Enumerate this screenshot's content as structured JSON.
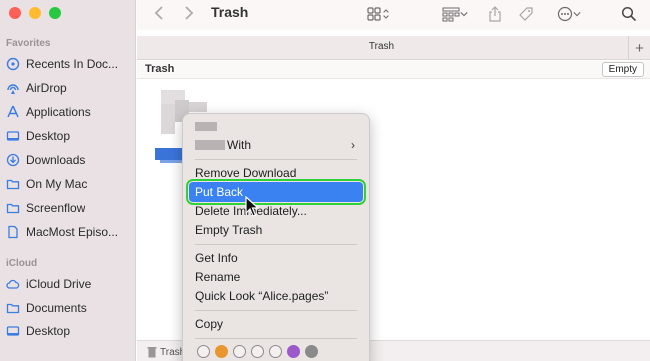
{
  "sidebar": {
    "favorites_label": "Favorites",
    "icloud_label": "iCloud",
    "favorites": [
      {
        "label": "Recents In Doc...",
        "icon": "recents-icon"
      },
      {
        "label": "AirDrop",
        "icon": "airdrop-icon"
      },
      {
        "label": "Applications",
        "icon": "applications-icon"
      },
      {
        "label": "Desktop",
        "icon": "desktop-icon"
      },
      {
        "label": "Downloads",
        "icon": "downloads-icon"
      },
      {
        "label": "On My Mac",
        "icon": "folder-icon"
      },
      {
        "label": "Screenflow",
        "icon": "folder-icon"
      },
      {
        "label": "MacMost Episo...",
        "icon": "document-icon"
      }
    ],
    "icloud": [
      {
        "label": "iCloud Drive",
        "icon": "cloud-icon"
      },
      {
        "label": "Documents",
        "icon": "folder-icon"
      },
      {
        "label": "Desktop",
        "icon": "desktop-icon"
      }
    ]
  },
  "toolbar": {
    "title": "Trash"
  },
  "tabbar": {
    "title": "Trash",
    "add": "+"
  },
  "pathbar": {
    "label": "Trash",
    "empty_button": "Empty"
  },
  "status": {
    "label": "Trash"
  },
  "menu": {
    "open_with": "With",
    "remove_download": "Remove Download",
    "put_back": "Put Back",
    "delete_immediately": "Delete Immediately...",
    "empty_trash": "Empty Trash",
    "get_info": "Get Info",
    "rename": "Rename",
    "quick_look": "Quick Look “Alice.pages”",
    "copy": "Copy",
    "submenu_arrow": "›"
  },
  "colors": {
    "selection": "#3a82f2",
    "highlight_outline": "#2fd338",
    "tags": [
      "#ffffff",
      "#e8962f",
      "#ffffff",
      "#ffffff",
      "#ffffff",
      "#9b59c9",
      "#8a8a8a"
    ]
  }
}
